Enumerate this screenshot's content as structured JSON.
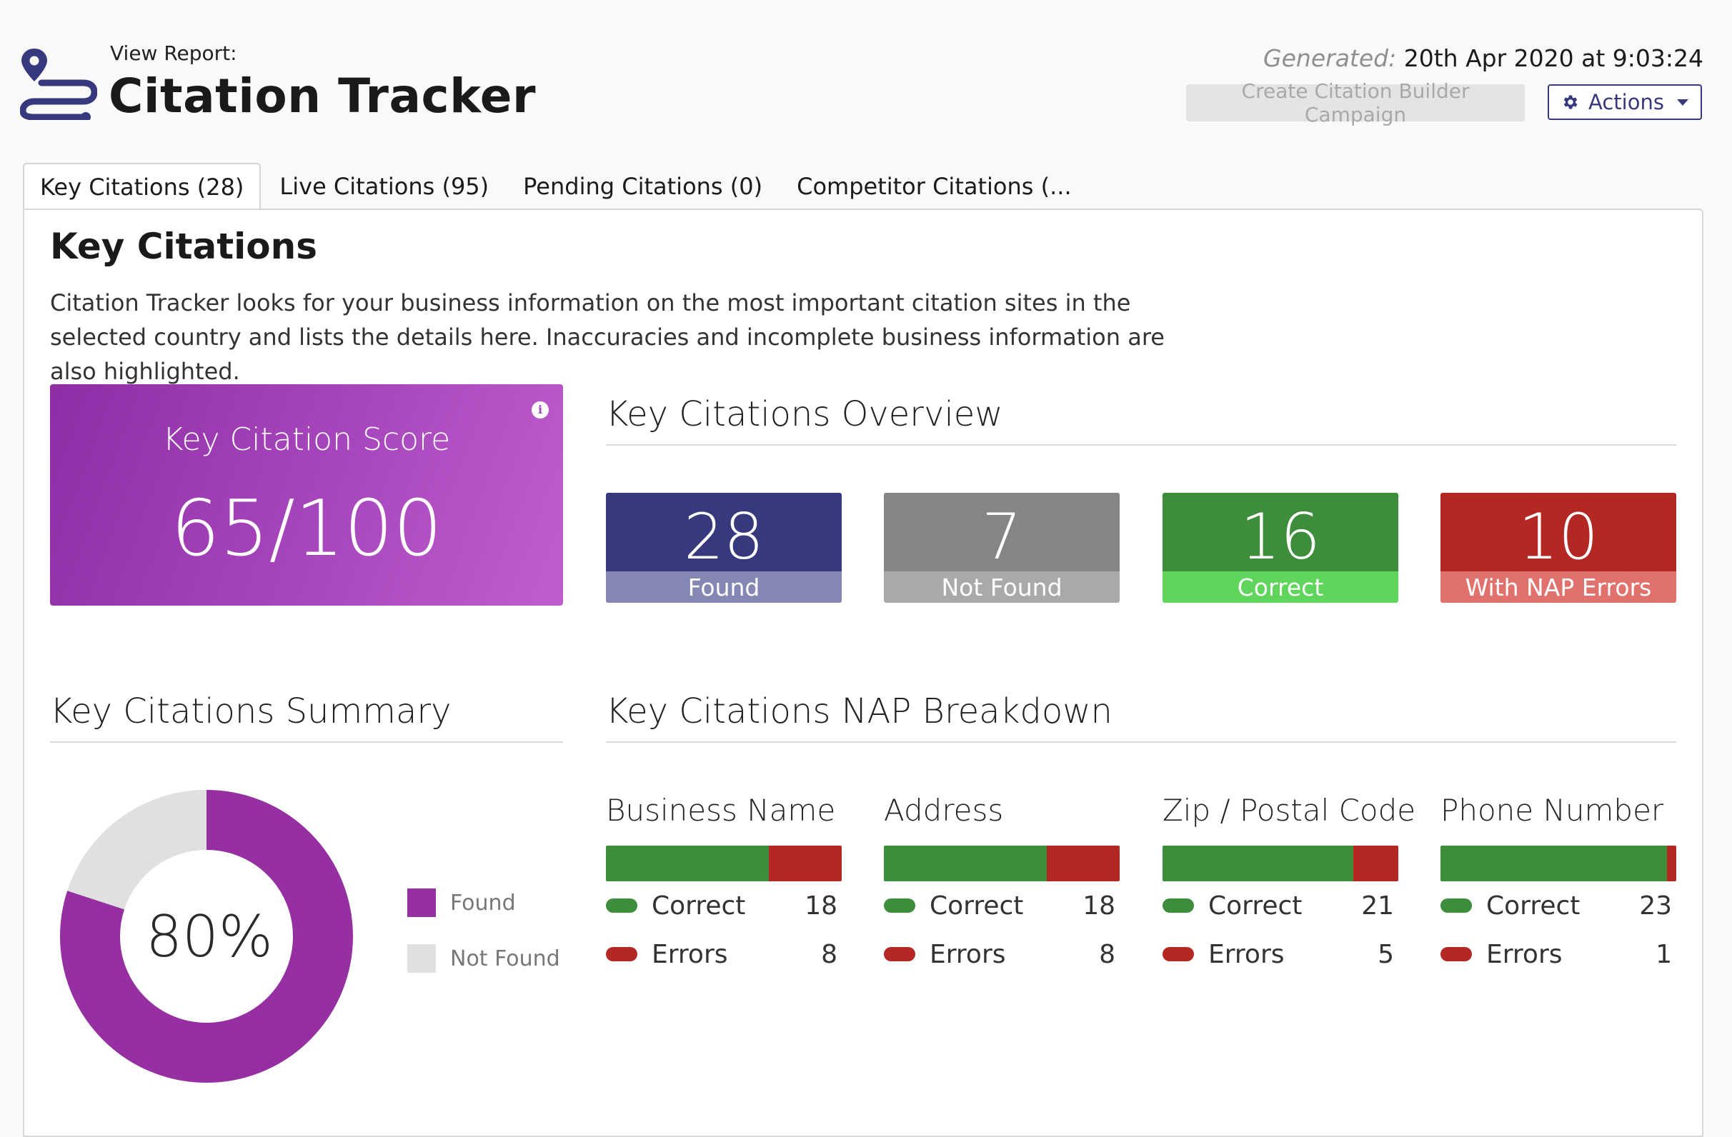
{
  "header": {
    "view_report_label": "View Report:",
    "title": "Citation Tracker",
    "generated_label": "Generated:",
    "generated_value": "20th Apr 2020 at 9:03:24",
    "create_campaign_label": "Create Citation Builder Campaign",
    "actions_label": "Actions"
  },
  "tabs": [
    {
      "label": "Key Citations (28)",
      "active": true
    },
    {
      "label": "Live Citations (95)"
    },
    {
      "label": "Pending Citations (0)"
    },
    {
      "label": "Competitor Citations (..."
    }
  ],
  "main": {
    "title": "Key Citations",
    "description": "Citation Tracker looks for your business information on the most important citation sites in the selected country and lists the details here. Inaccuracies and incomplete business information are also highlighted."
  },
  "score": {
    "label": "Key Citation Score",
    "value": "65/100"
  },
  "overview": {
    "title": "Key Citations Overview",
    "stats": [
      {
        "value": "28",
        "label": "Found",
        "top": "#37397e",
        "bottom": "#8487b4"
      },
      {
        "value": "7",
        "label": "Not Found",
        "top": "#858585",
        "bottom": "#a9a9a9"
      },
      {
        "value": "16",
        "label": "Correct",
        "top": "#3e8d3d",
        "bottom": "#5fd55c"
      },
      {
        "value": "10",
        "label": "With NAP Errors",
        "top": "#b42823",
        "bottom": "#e0716d"
      }
    ]
  },
  "summary": {
    "title": "Key Citations Summary",
    "center_label": "80%",
    "found_fraction": 0.8,
    "legend": [
      {
        "label": "Found",
        "color": "#962fa1"
      },
      {
        "label": "Not Found",
        "color": "#e0e0e0"
      }
    ]
  },
  "nap": {
    "title": "Key Citations NAP Breakdown",
    "correct_label": "Correct",
    "errors_label": "Errors",
    "columns": [
      {
        "title": "Business Name",
        "correct": "18",
        "errors": "8",
        "correct_fraction": 0.69
      },
      {
        "title": "Address",
        "correct": "18",
        "errors": "8",
        "correct_fraction": 0.69
      },
      {
        "title": "Zip / Postal Code",
        "correct": "21",
        "errors": "5",
        "correct_fraction": 0.81
      },
      {
        "title": "Phone Number",
        "correct": "23",
        "errors": "1",
        "correct_fraction": 0.96
      }
    ]
  },
  "colors": {
    "brand": "#37397e",
    "correct": "#3e8d3d",
    "error": "#b42823",
    "score_purple": "#a847bd"
  },
  "icons": {
    "logo": "location-route-icon",
    "actions": "gear-icon",
    "info": "info-icon"
  }
}
